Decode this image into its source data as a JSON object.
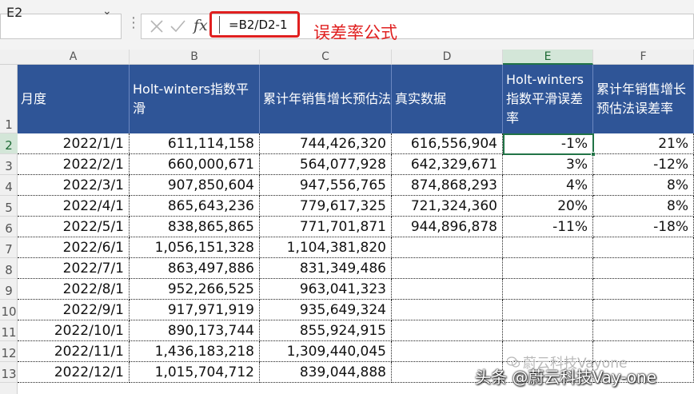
{
  "formula_bar": {
    "name_box": "E2",
    "fx": "fx",
    "formula": "=B2/D2-1"
  },
  "annotation": "误差率公式",
  "columns": [
    "A",
    "B",
    "C",
    "D",
    "E",
    "F"
  ],
  "rows": [
    "1",
    "2",
    "3",
    "4",
    "5",
    "6",
    "7",
    "8",
    "9",
    "10",
    "11",
    "12",
    "13"
  ],
  "headers": {
    "a": "月度",
    "b": "Holt-winters指数平滑",
    "c": "累计年销售增长预估法",
    "d": "真实数据",
    "e": "Holt-winters指数平滑误差率",
    "f": "累计年销售增长预估法误差率"
  },
  "table": [
    {
      "month": "2022/1/1",
      "holt": "611,114,158",
      "cum": "744,426,320",
      "real": "616,556,904",
      "err_holt": "-1%",
      "err_cum": "21%"
    },
    {
      "month": "2022/2/1",
      "holt": "660,000,671",
      "cum": "564,077,928",
      "real": "642,329,671",
      "err_holt": "3%",
      "err_cum": "-12%"
    },
    {
      "month": "2022/3/1",
      "holt": "907,850,604",
      "cum": "947,556,765",
      "real": "874,868,293",
      "err_holt": "4%",
      "err_cum": "8%"
    },
    {
      "month": "2022/4/1",
      "holt": "865,643,236",
      "cum": "779,617,325",
      "real": "721,324,360",
      "err_holt": "20%",
      "err_cum": "8%"
    },
    {
      "month": "2022/5/1",
      "holt": "838,865,865",
      "cum": "771,701,871",
      "real": "944,896,878",
      "err_holt": "-11%",
      "err_cum": "-18%"
    },
    {
      "month": "2022/6/1",
      "holt": "1,056,151,328",
      "cum": "1,104,381,820",
      "real": "",
      "err_holt": "",
      "err_cum": ""
    },
    {
      "month": "2022/7/1",
      "holt": "863,497,886",
      "cum": "831,349,486",
      "real": "",
      "err_holt": "",
      "err_cum": ""
    },
    {
      "month": "2022/8/1",
      "holt": "952,266,525",
      "cum": "963,041,323",
      "real": "",
      "err_holt": "",
      "err_cum": ""
    },
    {
      "month": "2022/9/1",
      "holt": "917,971,919",
      "cum": "935,649,324",
      "real": "",
      "err_holt": "",
      "err_cum": ""
    },
    {
      "month": "2022/10/1",
      "holt": "890,173,744",
      "cum": "855,924,915",
      "real": "",
      "err_holt": "",
      "err_cum": ""
    },
    {
      "month": "2022/11/1",
      "holt": "1,436,183,218",
      "cum": "1,309,440,045",
      "real": "",
      "err_holt": "",
      "err_cum": ""
    },
    {
      "month": "2022/12/1",
      "holt": "1,015,704,712",
      "cum": "839,044,888",
      "real": "",
      "err_holt": "",
      "err_cum": ""
    }
  ],
  "watermarks": {
    "wechat": "蔚云科技Vayone",
    "toutiao": "头条 @蔚云科技Vay-one"
  }
}
